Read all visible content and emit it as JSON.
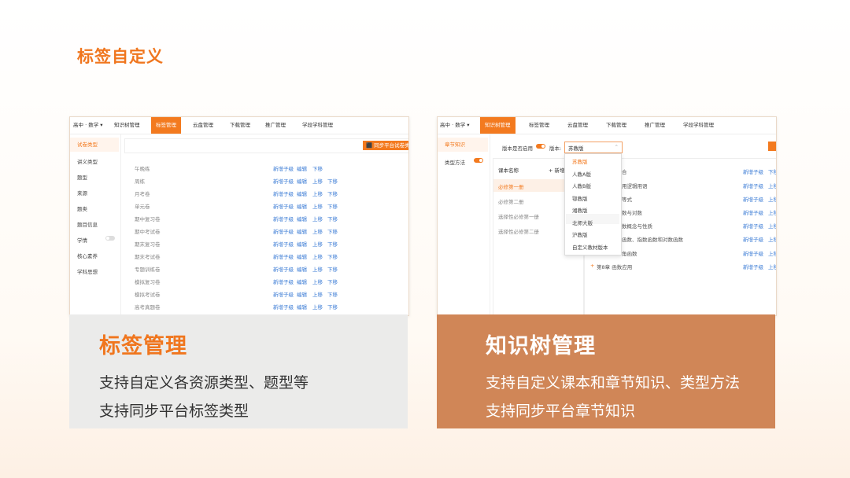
{
  "page": {
    "title": "标签自定义"
  },
  "left_card": {
    "caption": {
      "title": "标签管理",
      "line1": "支持自定义各资源类型、题型等",
      "line2": "支持同步平台标签类型"
    },
    "ui": {
      "grade": "高中 · 数学",
      "nav": [
        "知识树管理",
        "标签管理",
        "云盘管理",
        "下载管理",
        "推广管理",
        "学段学科管理"
      ],
      "active_nav": 1,
      "sidebar": [
        "试卷类型",
        "讲义类型",
        "题型",
        "来源",
        "题类",
        "题目信息",
        "学情",
        "核心素养",
        "学科思想"
      ],
      "sync_button": "同步平台试卷类",
      "rows": [
        "午晚练",
        "周练",
        "月考卷",
        "单元卷",
        "期中复习卷",
        "期中考试卷",
        "期末复习卷",
        "期末考试卷",
        "专题训练卷",
        "模拟复习卷",
        "模拟考试卷",
        "高考真题卷"
      ],
      "actions": {
        "add_child": "新增子级",
        "edit": "编辑",
        "up": "上移",
        "down": "下移"
      }
    }
  },
  "right_card": {
    "caption": {
      "title": "知识树管理",
      "line1": "支持自定义课本和章节知识、类型方法",
      "line2": "支持同步平台章节知识"
    },
    "ui": {
      "grade": "高中 · 数学",
      "nav": [
        "知识树管理",
        "标签管理",
        "云盘管理",
        "下载管理",
        "推广管理",
        "学段学科管理"
      ],
      "active_nav": 0,
      "sidebar": [
        "章节知识",
        "类型方法"
      ],
      "toggle_label": "版本是否启用",
      "version_label": "版本:",
      "version_value": "苏教版",
      "dropdown": [
        "苏教版",
        "人教A版",
        "人教B版",
        "鄂教版",
        "湘教版",
        "北师大版",
        "沪教版",
        "自定义教材版本"
      ],
      "textbook_header": "课本名称",
      "add_label": "+ 新增",
      "textbooks": [
        "必修第一册",
        "必修第二册",
        "选择性必修第一册",
        "选择性必修第二册"
      ],
      "chapters": [
        "合",
        "用逻辑用语",
        "等式",
        "数与对数",
        "数概念与性质",
        "函数、指数函数和对数函数",
        "角函数",
        "第8章 函数应用"
      ],
      "actions": {
        "add_child": "新增子级",
        "down": "下移",
        "up": "上移"
      }
    }
  },
  "colors": {
    "accent": "#f37a1f",
    "title": "#f0761e",
    "link": "#3a7bd5",
    "right_caption_bg": "#d08657",
    "left_caption_bg": "#ebebea"
  }
}
